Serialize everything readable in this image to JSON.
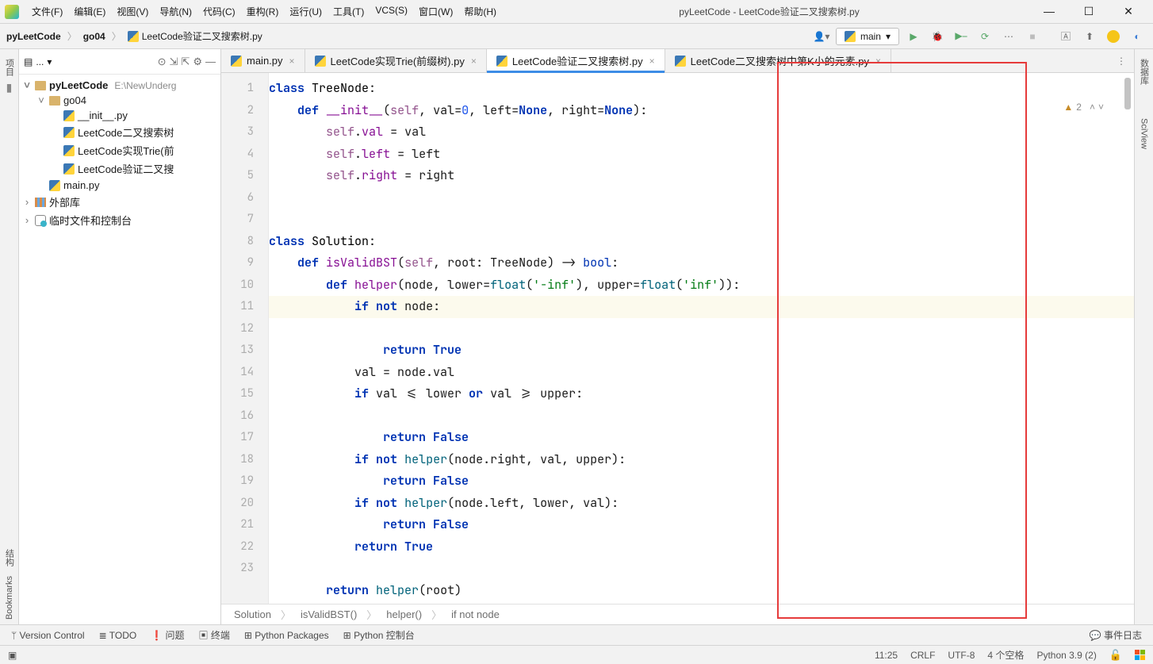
{
  "title": "pyLeetCode - LeetCode验证二叉搜索树.py",
  "menu": [
    "文件(F)",
    "编辑(E)",
    "视图(V)",
    "导航(N)",
    "代码(C)",
    "重构(R)",
    "运行(U)",
    "工具(T)",
    "VCS(S)",
    "窗口(W)",
    "帮助(H)"
  ],
  "breadcrumbs": {
    "root": "pyLeetCode",
    "dir": "go04",
    "file": "LeetCode验证二叉搜索树.py"
  },
  "run_config": "main",
  "left_tabs": {
    "project": "项目",
    "structure": "结构",
    "bookmarks": "Bookmarks"
  },
  "right_tabs": {
    "db": "数据库",
    "sciview": "SciView"
  },
  "project_panel": {
    "title": "...",
    "root": {
      "name": "pyLeetCode",
      "path": "E:\\NewUnderg"
    },
    "go04": "go04",
    "files": [
      "__init__.py",
      "LeetCode二叉搜索树",
      "LeetCode实现Trie(前",
      "LeetCode验证二叉搜",
      "main.py"
    ],
    "externals": "外部库",
    "scratch": "临时文件和控制台"
  },
  "tabs": [
    {
      "name": "main.py"
    },
    {
      "name": "LeetCode实现Trie(前缀树).py"
    },
    {
      "name": "LeetCode验证二叉搜索树.py",
      "active": true
    },
    {
      "name": "LeetCode二叉搜索树中第K小的元素.py"
    }
  ],
  "code_breadcrumb": [
    "Solution",
    "isValidBST()",
    "helper()",
    "if not node"
  ],
  "inspection": {
    "count": "2"
  },
  "bottom": {
    "vc": "Version Control",
    "todo": "TODO",
    "problems": "问题",
    "terminal": "终端",
    "packages": "Python Packages",
    "console": "Python 控制台",
    "eventlog": "事件日志"
  },
  "status": {
    "pos": "11:25",
    "eol": "CRLF",
    "enc": "UTF-8",
    "indent": "4 个空格",
    "python": "Python 3.9 (2)"
  },
  "code_lines": [
    "1",
    "2",
    "3",
    "4",
    "5",
    "6",
    "7",
    "8",
    "9",
    "10",
    "11",
    "12",
    "13",
    "14",
    "15",
    "16",
    "17",
    "18",
    "19",
    "20",
    "21",
    "22",
    "23"
  ],
  "code_tokens": {
    "class": "class",
    "def": "def",
    "self": "self",
    "__init__": "__init__",
    "TreeNode": "TreeNode",
    "Solution": "Solution",
    "val": "val",
    "left": "left",
    "right": "right",
    "None": "None",
    "zero": "0",
    "isValidBST": "isValidBST",
    "root": "root",
    "bool_tok": "bool",
    "helper": "helper",
    "node": "node",
    "lower": "lower",
    "upper": "upper",
    "float_tok": "float",
    "neg_inf": "'-inf'",
    "pos_inf": "'inf'",
    "if": "if",
    "not": "not",
    "return": "return",
    "True": "True",
    "False": "False",
    "or": "or"
  }
}
